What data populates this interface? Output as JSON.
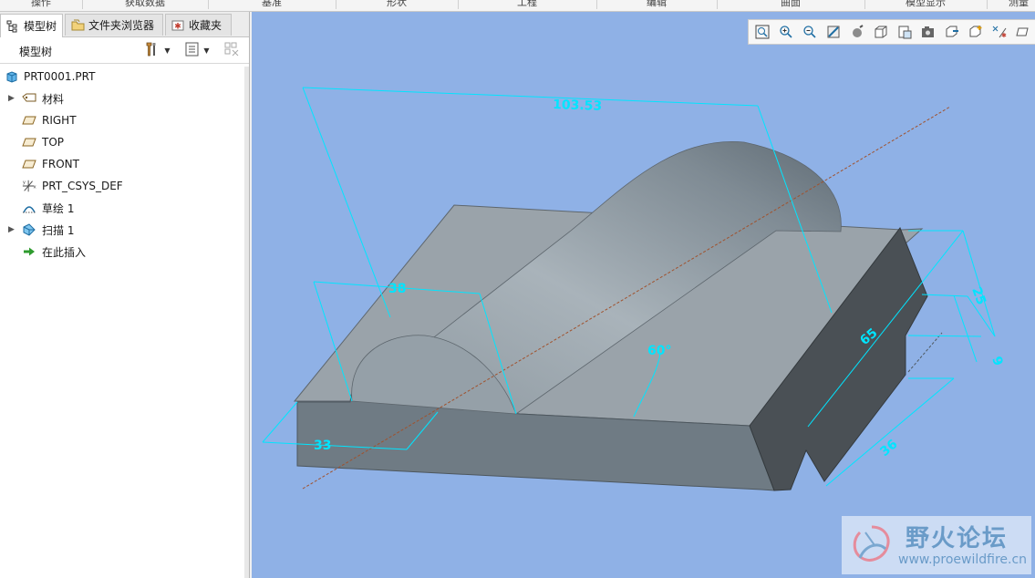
{
  "ribbon": {
    "items": [
      "操作",
      "获取数据",
      "基准",
      "形状",
      "工程",
      "编辑",
      "曲面",
      "模型显示",
      "测量"
    ]
  },
  "tabs": [
    {
      "label": "模型树",
      "icon": "model-tree-icon",
      "active": true
    },
    {
      "label": "文件夹浏览器",
      "icon": "folder-browser-icon",
      "active": false
    },
    {
      "label": "收藏夹",
      "icon": "favorites-icon",
      "active": false
    }
  ],
  "tree": {
    "title": "模型树",
    "items": [
      {
        "label": "PRT0001.PRT",
        "icon": "part-icon",
        "expandable": false
      },
      {
        "label": "材料",
        "icon": "material-icon",
        "expandable": true
      },
      {
        "label": "RIGHT",
        "icon": "datum-plane-icon",
        "expandable": false
      },
      {
        "label": "TOP",
        "icon": "datum-plane-icon",
        "expandable": false
      },
      {
        "label": "FRONT",
        "icon": "datum-plane-icon",
        "expandable": false
      },
      {
        "label": "PRT_CSYS_DEF",
        "icon": "csys-icon",
        "expandable": false
      },
      {
        "label": "草绘 1",
        "icon": "sketch-icon",
        "expandable": false
      },
      {
        "label": "扫描 1",
        "icon": "sweep-icon",
        "expandable": true
      },
      {
        "label": "在此插入",
        "icon": "insert-here-arrow-icon",
        "expandable": false
      }
    ]
  },
  "viewport": {
    "background": "#8fb1e6",
    "dimension_color": "#00e5ff",
    "dimensions": {
      "length": "103.53",
      "arc_width": "38",
      "left_offset": "33",
      "angle": "60°",
      "depth": "65",
      "height_top": "25",
      "step": "9",
      "bottom": "36"
    }
  },
  "view_toolbar": [
    "refit-icon",
    "zoom-in-icon",
    "zoom-out-icon",
    "repaint-icon",
    "display-style-icon",
    "saved-views-icon",
    "view-manager-icon",
    "perspective-icon",
    "section-icon",
    "datum-display-icon",
    "spin-center-icon",
    "annotation-display-icon"
  ],
  "watermark": {
    "text": "野火论坛",
    "url": "www.proewildfire.cn"
  }
}
